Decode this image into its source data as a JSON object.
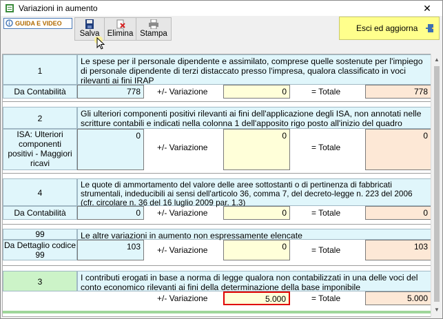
{
  "window": {
    "title": "Variazioni in aumento",
    "close_glyph": "✕"
  },
  "toolbar": {
    "guida_label": "GUIDA E VIDEO",
    "save_label": "Salva",
    "delete_label": "Elimina",
    "print_label": "Stampa",
    "exit_label": "Esci ed aggiorna"
  },
  "icons": [
    "guida-icon",
    "save-icon",
    "delete-icon",
    "print-icon",
    "exit-door-icon",
    "pointer-cursor-icon"
  ],
  "colors": {
    "accent_exit": "#ffff8c",
    "label_cell": "#e0f6fb",
    "variazione_field": "#ffffd9",
    "totale_field": "#fde8d6",
    "highlight_border": "#e00000"
  },
  "common": {
    "variazione_label": "+/- Variazione",
    "totale_label": "= Totale"
  },
  "rows": [
    {
      "code": "1",
      "description": "Le spese per il personale dipendente e assimilato, comprese quelle sostenute per l'impiego di personale dipendente di terzi distaccato presso l'impresa, qualora classificato in voci rilevanti ai fini IRAP",
      "source_label": "Da Contabilità",
      "source_value": "778",
      "variazione_value": "0",
      "totale_value": "778"
    },
    {
      "code": "2",
      "description": "Gli ulteriori componenti positivi rilevanti ai fini dell'applicazione degli ISA, non annotati nelle scritture contabili e indicati nella colonna 1 dell'apposito rigo posto all'inizio del quadro",
      "source_label": "ISA: Ulteriori componenti positivi - Maggiori ricavi",
      "source_value": "0",
      "variazione_value": "0",
      "totale_value": "0"
    },
    {
      "code": "4",
      "description": "Le quote di ammortamento del valore delle aree sottostanti o di pertinenza di fabbricati strumentali, indeducibili ai sensi dell'articolo 36, comma 7, del decreto-legge n. 223 del 2006 (cfr. circolare n. 36 del 16 luglio 2009 par. 1.3)",
      "source_label": "Da Contabilità",
      "source_value": "0",
      "variazione_value": "0",
      "totale_value": "0"
    },
    {
      "code": "99",
      "description": "Le altre variazioni in aumento non espressamente elencate",
      "source_label": "Da Dettaglio codice 99",
      "source_value": "103",
      "variazione_value": "0",
      "totale_value": "103"
    },
    {
      "code": "3",
      "description": "I contributi erogati in base a norma di legge qualora non contabilizzati in una delle voci del conto economico rilevanti ai fini della determinazione della base imponibile",
      "variazione_value": "5.000",
      "totale_value": "5.000"
    }
  ]
}
